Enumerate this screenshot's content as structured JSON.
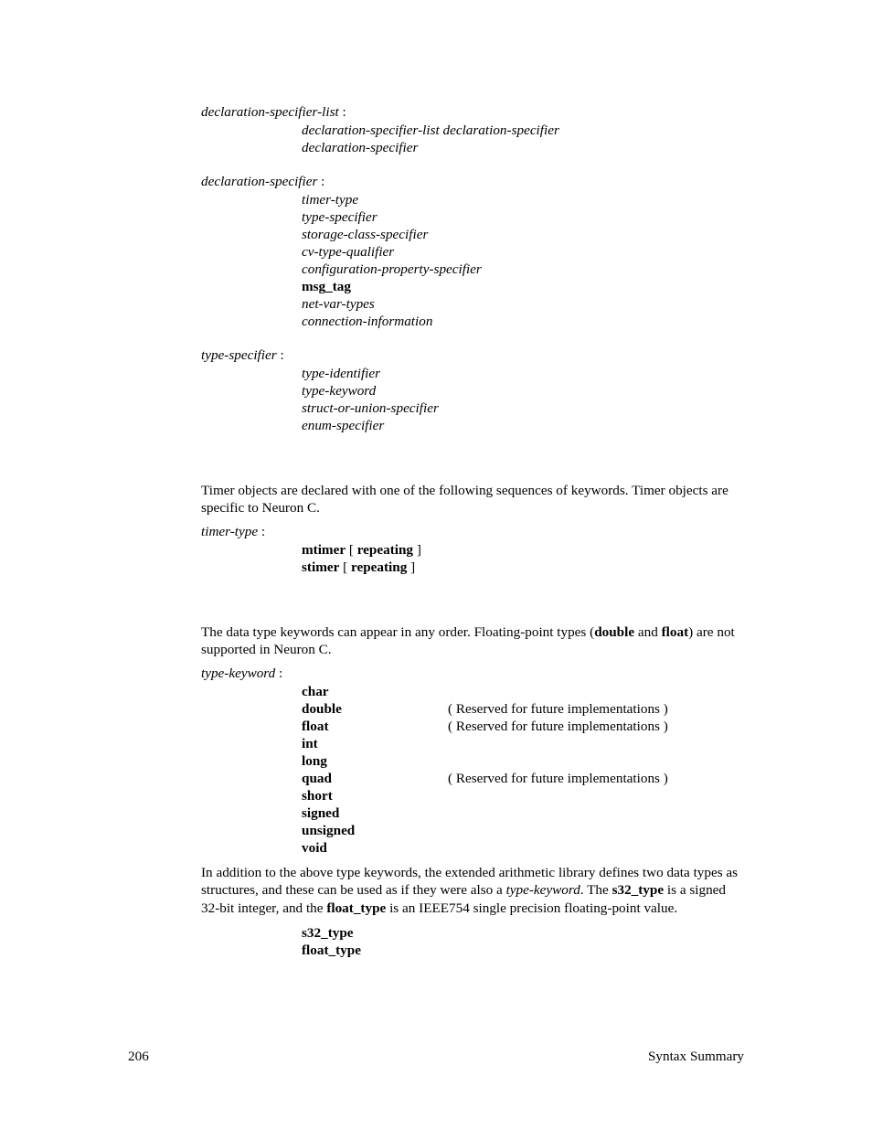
{
  "productions": {
    "decl_spec_list_head": "declaration-specifier-list",
    "decl_spec_list_alts": [
      "declaration-specifier-list  declaration-specifier",
      "declaration-specifier"
    ],
    "decl_spec_head": "declaration-specifier",
    "decl_spec_alts": [
      {
        "text": "timer-type",
        "style": "it"
      },
      {
        "text": "type-specifier",
        "style": "it"
      },
      {
        "text": "storage-class-specifier",
        "style": "it"
      },
      {
        "text": "cv-type-qualifier",
        "style": "it"
      },
      {
        "text": "configuration-property-specifier",
        "style": "it"
      },
      {
        "text": "msg_tag",
        "style": "bold"
      },
      {
        "text": "net-var-types",
        "style": "it"
      },
      {
        "text": "connection-information",
        "style": "it"
      }
    ],
    "type_spec_head": "type-specifier",
    "type_spec_alts": [
      "type-identifier",
      "type-keyword",
      "struct-or-union-specifier",
      "enum-specifier"
    ]
  },
  "timer": {
    "para": "Timer objects are declared with one of the following sequences of keywords. Timer objects are specific to Neuron C.",
    "head": "timer-type",
    "alts": [
      {
        "kw": "mtimer",
        "opt": "repeating"
      },
      {
        "kw": "stimer",
        "opt": "repeating"
      }
    ]
  },
  "typekw": {
    "para_pre": "The data type keywords can appear in any order.  Floating-point types (",
    "para_double": "double",
    "para_and": " and ",
    "para_float": "float",
    "para_post": ") are not supported in Neuron C.",
    "head": "type-keyword",
    "rows": [
      {
        "kw": "char",
        "note": ""
      },
      {
        "kw": "double",
        "note": "( Reserved for future implementations )"
      },
      {
        "kw": "float",
        "note": "( Reserved for future implementations )"
      },
      {
        "kw": "int",
        "note": ""
      },
      {
        "kw": "long",
        "note": ""
      },
      {
        "kw": "quad",
        "note": "( Reserved for future implementations )"
      },
      {
        "kw": "short",
        "note": ""
      },
      {
        "kw": "signed",
        "note": ""
      },
      {
        "kw": "unsigned",
        "note": ""
      },
      {
        "kw": "void",
        "note": ""
      }
    ]
  },
  "ext": {
    "p1": "In addition to the above type keywords, the extended arithmetic library defines two data types as structures, and these can be used as if they were also a ",
    "p1_it": "type-keyword",
    "p2a": ".  The ",
    "p2b": "s32_type",
    "p2c": " is a signed 32-bit integer, and the ",
    "p2d": "float_type",
    "p2e": " is an IEEE754 single precision floating-point value.",
    "kws": [
      "s32_type",
      "float_type"
    ]
  },
  "footer": {
    "page": "206",
    "title": "Syntax Summary"
  },
  "common": {
    "colon": " :",
    "lbracket": " [ ",
    "rbracket": " ]"
  }
}
